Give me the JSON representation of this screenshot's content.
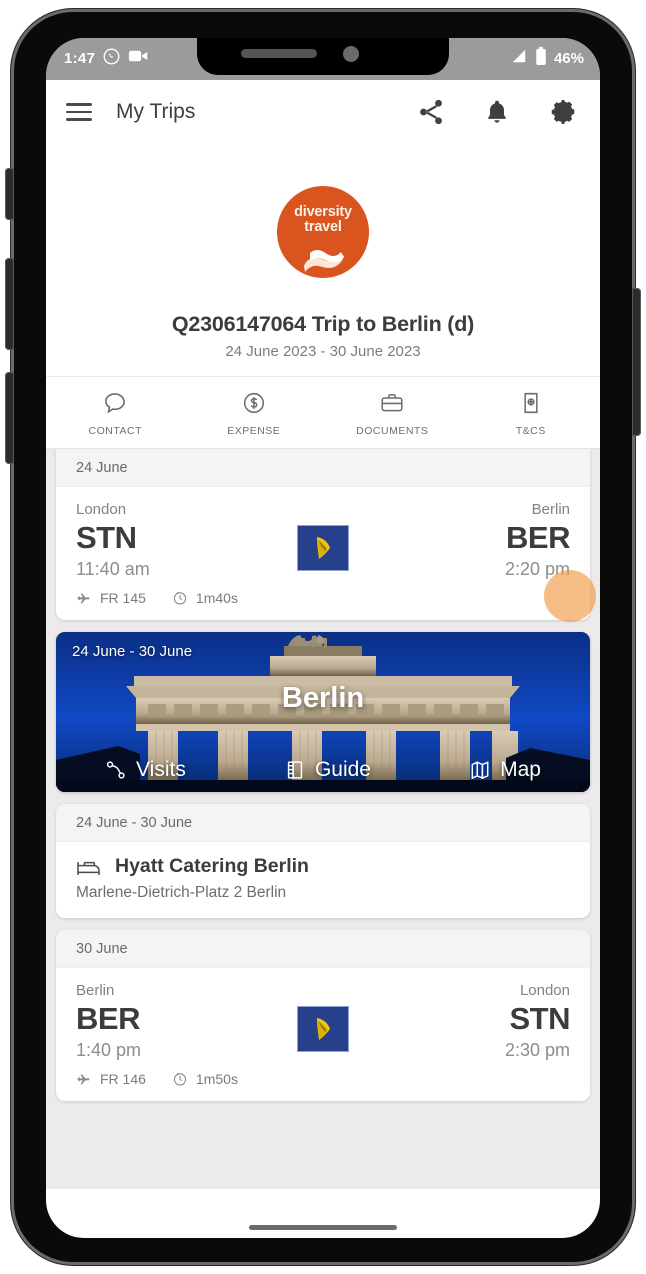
{
  "status_bar": {
    "time": "1:47",
    "battery_percent": "46%",
    "icons": [
      "whatsapp-icon",
      "video-camera-icon",
      "signal-icon",
      "battery-icon"
    ]
  },
  "app_bar": {
    "menu_icon": "hamburger-menu-icon",
    "title": "My Trips",
    "actions": [
      {
        "icon": "share-icon",
        "name": "share-button"
      },
      {
        "icon": "bell-icon",
        "name": "notifications-button"
      },
      {
        "icon": "gear-icon",
        "name": "settings-button"
      }
    ]
  },
  "brand": {
    "name_line1": "diversity",
    "name_line2": "travel",
    "color": "#d9541e"
  },
  "trip": {
    "title": "Q2306147064 Trip to Berlin (d)",
    "dates": "24 June 2023 - 30 June 2023"
  },
  "quick_actions": [
    {
      "label": "CONTACT",
      "icon": "speech-bubble-icon"
    },
    {
      "label": "EXPENSE",
      "icon": "dollar-circle-icon"
    },
    {
      "label": "DOCUMENTS",
      "icon": "briefcase-icon"
    },
    {
      "label": "T&CS",
      "icon": "terms-document-icon"
    }
  ],
  "itinerary": {
    "outbound_flight": {
      "date": "24 June",
      "from_city": "London",
      "from_code": "STN",
      "from_time": "11:40 am",
      "to_city": "Berlin",
      "to_code": "BER",
      "to_time": "2:20 pm",
      "flight_number": "FR 145",
      "duration": "1m40s",
      "airline_logo": "ryanair-harp-logo",
      "airline_logo_color": "#26408b"
    },
    "destination": {
      "dates": "24 June - 30 June",
      "name": "Berlin",
      "actions": [
        {
          "label": "Visits",
          "icon": "route-icon"
        },
        {
          "label": "Guide",
          "icon": "book-icon"
        },
        {
          "label": "Map",
          "icon": "map-icon"
        }
      ]
    },
    "hotel": {
      "dates": "24 June - 30 June",
      "name": "Hyatt Catering Berlin",
      "address": "Marlene-Dietrich-Platz 2 Berlin",
      "icon": "bed-icon"
    },
    "return_flight": {
      "date": "30 June",
      "from_city": "Berlin",
      "from_code": "BER",
      "from_time": "1:40 pm",
      "to_city": "London",
      "to_code": "STN",
      "to_time": "2:30 pm",
      "flight_number": "FR 146",
      "duration": "1m50s",
      "airline_logo": "ryanair-harp-logo",
      "airline_logo_color": "#26408b"
    }
  }
}
